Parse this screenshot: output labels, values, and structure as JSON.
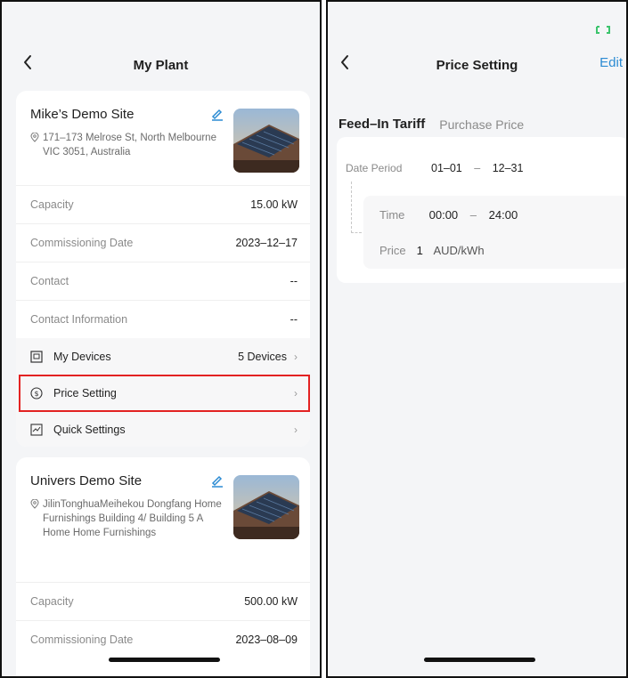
{
  "left": {
    "title": "My Plant",
    "sites": [
      {
        "name": "Mike’s Demo Site",
        "address": "171–173 Melrose St, North Melbourne VIC 3051, Australia",
        "rows": [
          {
            "label": "Capacity",
            "value": "15.00 kW"
          },
          {
            "label": "Commissioning Date",
            "value": "2023–12–17"
          },
          {
            "label": "Contact",
            "value": "--"
          },
          {
            "label": "Contact Information",
            "value": "--"
          }
        ],
        "menu": [
          {
            "label": "My Devices",
            "value": "5 Devices",
            "icon": "monitor-icon"
          },
          {
            "label": "Price Setting",
            "value": "",
            "icon": "dollar-circle-icon"
          },
          {
            "label": "Quick Settings",
            "value": "",
            "icon": "chart-icon"
          }
        ]
      },
      {
        "name": "Univers Demo Site",
        "address": "JilinTonghuaMeihekou Dongfang Home Furnishings Building 4/ Building 5 A Home Home Furnishings",
        "rows": [
          {
            "label": "Capacity",
            "value": "500.00 kW"
          },
          {
            "label": "Commissioning Date",
            "value": "2023–08–09"
          }
        ]
      }
    ]
  },
  "right": {
    "title": "Price Setting",
    "edit_label": "Edit",
    "tabs": [
      "Feed–In Tariff",
      "Purchase Price"
    ],
    "date_period_label": "Date Period",
    "date_start": "01–01",
    "date_end": "12–31",
    "time_label": "Time",
    "time_start": "00:00",
    "time_end": "24:00",
    "price_label": "Price",
    "price_value": "1",
    "price_unit": "AUD/kWh",
    "dash": "–"
  },
  "colors": {
    "accent": "#2b8bd3",
    "highlight": "#e32222",
    "battery": "#3cc46d"
  }
}
